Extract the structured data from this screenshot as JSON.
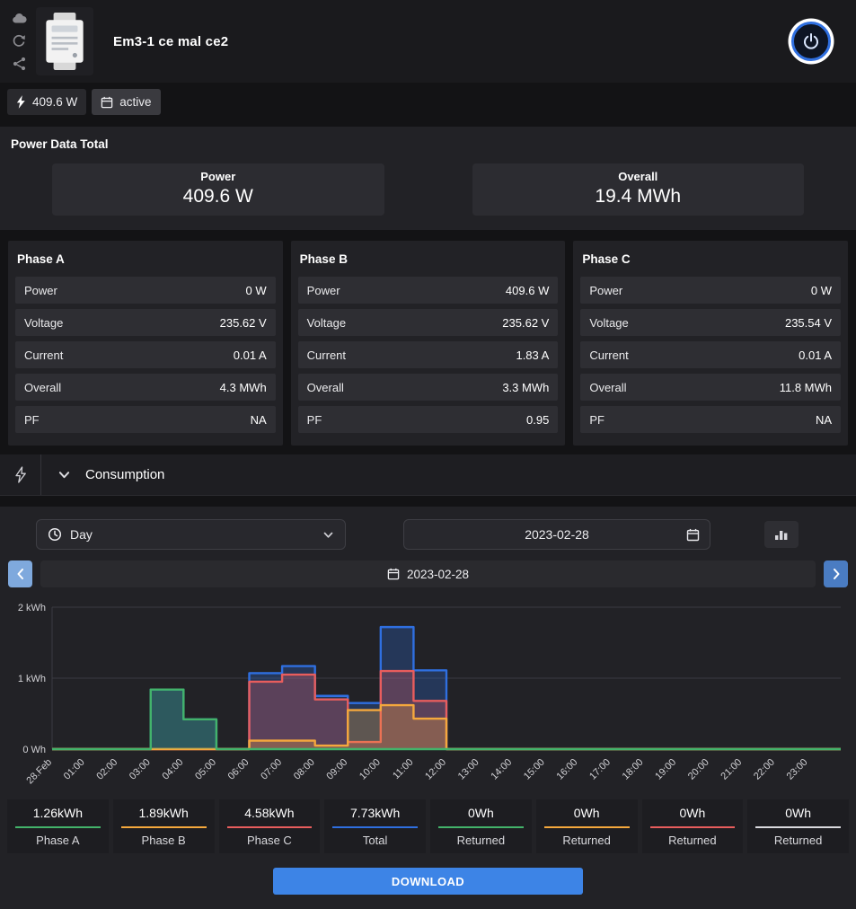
{
  "header": {
    "title": "Em3-1 ce mal ce2"
  },
  "badges": {
    "power": "409.6 W",
    "schedule": "active"
  },
  "power_total": {
    "section_title": "Power Data Total",
    "cards": [
      {
        "label": "Power",
        "value": "409.6 W"
      },
      {
        "label": "Overall",
        "value": "19.4 MWh"
      }
    ]
  },
  "phases": [
    {
      "title": "Phase A",
      "rows": [
        {
          "label": "Power",
          "value": "0 W"
        },
        {
          "label": "Voltage",
          "value": "235.62 V"
        },
        {
          "label": "Current",
          "value": "0.01 A"
        },
        {
          "label": "Overall",
          "value": "4.3 MWh"
        },
        {
          "label": "PF",
          "value": "NA"
        }
      ]
    },
    {
      "title": "Phase B",
      "rows": [
        {
          "label": "Power",
          "value": "409.6 W"
        },
        {
          "label": "Voltage",
          "value": "235.62 V"
        },
        {
          "label": "Current",
          "value": "1.83 A"
        },
        {
          "label": "Overall",
          "value": "3.3 MWh"
        },
        {
          "label": "PF",
          "value": "0.95"
        }
      ]
    },
    {
      "title": "Phase C",
      "rows": [
        {
          "label": "Power",
          "value": "0 W"
        },
        {
          "label": "Voltage",
          "value": "235.54 V"
        },
        {
          "label": "Current",
          "value": "0.01 A"
        },
        {
          "label": "Overall",
          "value": "11.8 MWh"
        },
        {
          "label": "PF",
          "value": "NA"
        }
      ]
    }
  ],
  "consumption": {
    "section_title": "Consumption",
    "period_select": "Day",
    "date_value": "2023-02-28",
    "nav_date": "2023-02-28",
    "download_label": "DOWNLOAD",
    "accent_color": "#3d84e6",
    "legend": [
      {
        "value": "1.26kWh",
        "label": "Phase A",
        "color": "#43b36a"
      },
      {
        "value": "1.89kWh",
        "label": "Phase B",
        "color": "#f5a83d"
      },
      {
        "value": "4.58kWh",
        "label": "Phase C",
        "color": "#e85d5d"
      },
      {
        "value": "7.73kWh",
        "label": "Total",
        "color": "#2f6fe0"
      },
      {
        "value": "0Wh",
        "label": "Returned",
        "color": "#43b36a"
      },
      {
        "value": "0Wh",
        "label": "Returned",
        "color": "#f5a83d"
      },
      {
        "value": "0Wh",
        "label": "Returned",
        "color": "#e85d5d"
      },
      {
        "value": "0Wh",
        "label": "Returned",
        "color": "#d9d9de"
      }
    ]
  },
  "chart_data": {
    "type": "area",
    "subtype": "step",
    "title": "Daily consumption per phase, 2023-02-28",
    "xlabel": "",
    "ylabel": "",
    "unit": "kWh",
    "ylim": [
      0,
      2
    ],
    "grid": true,
    "yticks": [
      {
        "v": 0,
        "label": "0 Wh"
      },
      {
        "v": 1,
        "label": "1 kWh"
      },
      {
        "v": 2,
        "label": "2 kWh"
      }
    ],
    "x": [
      "28.Feb",
      "01:00",
      "02:00",
      "03:00",
      "04:00",
      "05:00",
      "06:00",
      "07:00",
      "08:00",
      "09:00",
      "10:00",
      "11:00",
      "12:00",
      "13:00",
      "14:00",
      "15:00",
      "16:00",
      "17:00",
      "18:00",
      "19:00",
      "20:00",
      "21:00",
      "22:00",
      "23:00"
    ],
    "series": [
      {
        "name": "Total",
        "color": "#2f6fe0",
        "total": "7.73kWh",
        "values": [
          0,
          0,
          0,
          0.84,
          0.42,
          0,
          1.07,
          1.17,
          0.75,
          0.65,
          1.72,
          1.11,
          0,
          0,
          0,
          0,
          0,
          0,
          0,
          0,
          0,
          0,
          0,
          0
        ]
      },
      {
        "name": "Phase C",
        "color": "#e85d5d",
        "total": "4.58kWh",
        "values": [
          0,
          0,
          0,
          0,
          0,
          0,
          0.95,
          1.05,
          0.7,
          0.1,
          1.1,
          0.68,
          0,
          0,
          0,
          0,
          0,
          0,
          0,
          0,
          0,
          0,
          0,
          0
        ]
      },
      {
        "name": "Phase B",
        "color": "#f5a83d",
        "total": "1.89kWh",
        "values": [
          0,
          0,
          0,
          0,
          0,
          0,
          0.12,
          0.12,
          0.05,
          0.55,
          0.62,
          0.43,
          0,
          0,
          0,
          0,
          0,
          0,
          0,
          0,
          0,
          0,
          0,
          0
        ]
      },
      {
        "name": "Phase A",
        "color": "#43b36a",
        "total": "1.26kWh",
        "values": [
          0,
          0,
          0,
          0.84,
          0.42,
          0,
          0,
          0,
          0,
          0,
          0,
          0,
          0,
          0,
          0,
          0,
          0,
          0,
          0,
          0,
          0,
          0,
          0,
          0
        ]
      }
    ]
  }
}
